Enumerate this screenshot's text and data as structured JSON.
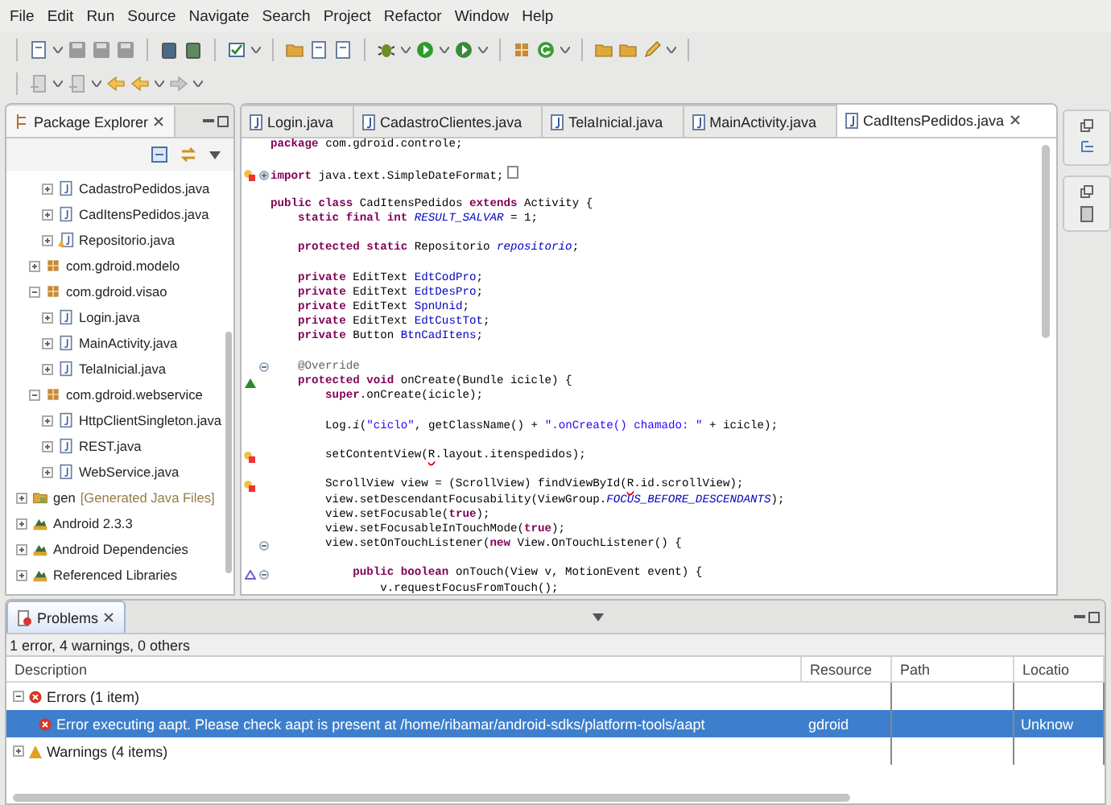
{
  "menu": [
    "File",
    "Edit",
    "Run",
    "Source",
    "Navigate",
    "Search",
    "Project",
    "Refactor",
    "Window",
    "Help"
  ],
  "explorer": {
    "title": "Package Explorer",
    "tree": [
      {
        "children": [
          {
            "children": [
              {
                "kind": "file",
                "label": "CadastroPedidos.java",
                "expanded": false
              },
              {
                "kind": "file",
                "label": "CadItensPedidos.java",
                "expanded": false
              },
              {
                "kind": "file_warning",
                "label": "Repositorio.java",
                "expanded": false
              }
            ]
          },
          {
            "kind": "package",
            "label": "com.gdroid.modelo",
            "expanded": false
          },
          {
            "kind": "package",
            "label": "com.gdroid.visao",
            "expanded": true,
            "children": [
              {
                "kind": "file",
                "label": "Login.java",
                "expanded": false
              },
              {
                "kind": "file",
                "label": "MainActivity.java",
                "expanded": false
              },
              {
                "kind": "file",
                "label": "TelaInicial.java",
                "expanded": false
              }
            ]
          },
          {
            "kind": "package",
            "label": "com.gdroid.webservice",
            "expanded": true,
            "children": [
              {
                "kind": "file",
                "label": "HttpClientSingleton.java",
                "expanded": false
              },
              {
                "kind": "file",
                "label": "REST.java",
                "expanded": false
              },
              {
                "kind": "file",
                "label": "WebService.java",
                "expanded": false
              }
            ]
          }
        ]
      },
      {
        "kind": "folder",
        "label": "gen",
        "decoration": "[Generated Java Files]",
        "expanded": false
      },
      {
        "kind": "library",
        "label": "Android 2.3.3",
        "expanded": false
      },
      {
        "kind": "library",
        "label": "Android Dependencies",
        "expanded": false
      },
      {
        "kind": "library",
        "label": "Referenced Libraries",
        "expanded": false
      }
    ]
  },
  "editor": {
    "tabs": [
      {
        "label": "Login.java",
        "selected": false
      },
      {
        "label": "CadastroClientes.java",
        "selected": false
      },
      {
        "label": "TelaInicial.java",
        "selected": false
      },
      {
        "label": "MainActivity.java",
        "selected": false
      },
      {
        "label": "CadItensPedidos.java",
        "selected": true
      }
    ],
    "lines": [
      {
        "segs": [
          {
            "kind": "keyword",
            "text": "package"
          },
          {
            "kind": "plain",
            "text": " com.gdroid.controle;"
          }
        ]
      },
      {
        "blank_before": true,
        "marker": {
          "kind": "quick_fix_error"
        },
        "folded": true,
        "segs": [
          {
            "kind": "keyword",
            "text": "import"
          },
          {
            "kind": "plain",
            "text": " java.text.SimpleDateFormat;"
          }
        ]
      },
      {
        "blank_before": true,
        "segs": [
          {
            "kind": "keyword",
            "text": "public class"
          },
          {
            "kind": "plain",
            "text": " CadItensPedidos "
          },
          {
            "kind": "keyword",
            "text": "extends"
          },
          {
            "kind": "plain",
            "text": " Activity {"
          }
        ]
      },
      {
        "segs": [
          {
            "kind": "keyword",
            "text": "    static final int "
          },
          {
            "kind": "static_field",
            "text": "RESULT_SALVAR"
          },
          {
            "kind": "plain",
            "text": " = 1;"
          }
        ]
      },
      {
        "blank_before": true,
        "segs": [
          {
            "kind": "keyword",
            "text": "    protected static"
          },
          {
            "kind": "plain",
            "text": " Repositorio "
          },
          {
            "kind": "static_field",
            "text": "repositorio"
          },
          {
            "kind": "plain",
            "text": ";"
          }
        ]
      },
      {
        "blank_before": true,
        "segs": [
          {
            "kind": "keyword",
            "text": "    private"
          },
          {
            "kind": "plain",
            "text": " EditText "
          },
          {
            "kind": "field",
            "text": "EdtCodPro"
          },
          {
            "kind": "plain",
            "text": ";"
          }
        ]
      },
      {
        "segs": [
          {
            "kind": "keyword",
            "text": "    private"
          },
          {
            "kind": "plain",
            "text": " EditText "
          },
          {
            "kind": "field",
            "text": "EdtDesPro"
          },
          {
            "kind": "plain",
            "text": ";"
          }
        ]
      },
      {
        "segs": [
          {
            "kind": "keyword",
            "text": "    private"
          },
          {
            "kind": "plain",
            "text": " EditText "
          },
          {
            "kind": "field",
            "text": "SpnUnid"
          },
          {
            "kind": "plain",
            "text": ";"
          }
        ]
      },
      {
        "segs": [
          {
            "kind": "keyword",
            "text": "    private"
          },
          {
            "kind": "plain",
            "text": " EditText "
          },
          {
            "kind": "field",
            "text": "EdtCustTot"
          },
          {
            "kind": "plain",
            "text": ";"
          }
        ]
      },
      {
        "segs": [
          {
            "kind": "keyword",
            "text": "    private"
          },
          {
            "kind": "plain",
            "text": " Button "
          },
          {
            "kind": "field",
            "text": "BtnCadItens"
          },
          {
            "kind": "plain",
            "text": ";"
          }
        ]
      },
      {
        "blank_before": true,
        "folded": false,
        "segs": [
          {
            "kind": "annotation",
            "text": "    @Override"
          }
        ]
      },
      {
        "marker": {
          "kind": "override"
        },
        "segs": [
          {
            "kind": "keyword",
            "text": "    protected void"
          },
          {
            "kind": "plain",
            "text": " onCreate(Bundle icicle) {"
          }
        ]
      },
      {
        "segs": [
          {
            "kind": "keyword",
            "text": "        super"
          },
          {
            "kind": "plain",
            "text": ".onCreate(icicle);"
          }
        ]
      },
      {
        "blank_before": true,
        "segs": [
          {
            "kind": "plain",
            "text": "        Log."
          },
          {
            "kind": "static_method",
            "text": "i"
          },
          {
            "kind": "plain",
            "text": "("
          },
          {
            "kind": "string",
            "text": "\"ciclo\""
          },
          {
            "kind": "plain",
            "text": ", getClassName() + "
          },
          {
            "kind": "string",
            "text": "\".onCreate() chamado: \""
          },
          {
            "kind": "plain",
            "text": " + icicle);"
          }
        ]
      },
      {
        "blank_before": true,
        "marker": {
          "kind": "quick_fix_error"
        },
        "segs": [
          {
            "kind": "plain",
            "text": "        setContentView("
          },
          {
            "kind": "error_ref",
            "text": "R"
          },
          {
            "kind": "plain",
            "text": ".layout.itenspedidos);"
          }
        ]
      },
      {
        "blank_before": true,
        "marker": {
          "kind": "quick_fix_error"
        },
        "segs": [
          {
            "kind": "plain",
            "text": "        ScrollView view = (ScrollView) findViewById("
          },
          {
            "kind": "error_ref",
            "text": "R"
          },
          {
            "kind": "plain",
            "text": ".id.scrollView);"
          }
        ]
      },
      {
        "segs": [
          {
            "kind": "plain",
            "text": "        view.setDescendantFocusability(ViewGroup."
          },
          {
            "kind": "static_field",
            "text": "FOCUS_BEFORE_DESCENDANTS"
          },
          {
            "kind": "plain",
            "text": ");"
          }
        ]
      },
      {
        "segs": [
          {
            "kind": "plain",
            "text": "        view.setFocusable("
          },
          {
            "kind": "keyword",
            "text": "true"
          },
          {
            "kind": "plain",
            "text": ");"
          }
        ]
      },
      {
        "segs": [
          {
            "kind": "plain",
            "text": "        view.setFocusableInTouchMode("
          },
          {
            "kind": "keyword",
            "text": "true"
          },
          {
            "kind": "plain",
            "text": ");"
          }
        ]
      },
      {
        "folded": false,
        "segs": [
          {
            "kind": "plain",
            "text": "        view.setOnTouchListener("
          },
          {
            "kind": "keyword",
            "text": "new"
          },
          {
            "kind": "plain",
            "text": " View.OnTouchListener() {"
          }
        ]
      },
      {
        "blank_before": true,
        "marker": {
          "kind": "implements"
        },
        "folded": false,
        "segs": [
          {
            "kind": "keyword",
            "text": "            public boolean"
          },
          {
            "kind": "plain",
            "text": " onTouch(View v, MotionEvent event) {"
          }
        ]
      },
      {
        "segs": [
          {
            "kind": "plain",
            "text": "                v.requestFocusFromTouch();"
          }
        ]
      }
    ]
  },
  "problems": {
    "title": "Problems",
    "summary": "1 error, 4 warnings, 0 others",
    "columns": [
      "Description",
      "Resource",
      "Path",
      "Locatio"
    ],
    "rows": [
      {
        "kind": "error_group",
        "label": "Errors (1 item)",
        "expanded": true,
        "children": [
          {
            "kind": "error",
            "selected": true,
            "cells": [
              "Error executing aapt. Please check aapt is present at /home/ribamar/android-sdks/platform-tools/aapt",
              "gdroid",
              "",
              "Unknow"
            ]
          }
        ]
      },
      {
        "kind": "warning_group",
        "label": "Warnings (4 items)",
        "expanded": false
      }
    ]
  }
}
